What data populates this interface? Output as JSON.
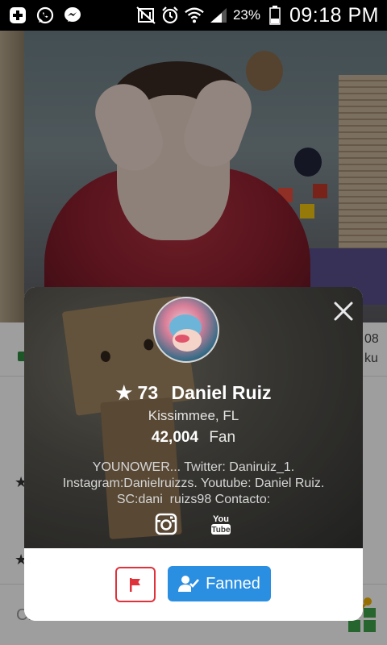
{
  "status_bar": {
    "battery_percent": "23%",
    "time": "09:18 PM",
    "icons": [
      "add-icon",
      "whatsapp-icon",
      "messenger-icon",
      "nfc-off-icon",
      "alarm-icon",
      "wifi-icon",
      "signal-icon",
      "battery-icon"
    ]
  },
  "profile_card": {
    "level_star": "★",
    "level": "73",
    "name": "Daniel Ruiz",
    "location": "Kissimmee, FL",
    "fan_count": "42,004",
    "fan_label": "Fan",
    "bio": "YOUNOWER... Twitter: Daniruiz_1. Instagram:Danielruizzs. Youtube: Daniel Ruiz. SC:dani_ruizs98 Contacto:",
    "social": [
      "instagram-icon",
      "youtube-icon"
    ],
    "fanned_label": "Fanned"
  },
  "background": {
    "partial_text_right_1": "08",
    "partial_text_right_2": "ku",
    "star_glyph": "★",
    "chat_placeholder": "Chat here..."
  },
  "colors": {
    "flag_red": "#e0323b",
    "fanned_blue": "#2a8ee1"
  }
}
